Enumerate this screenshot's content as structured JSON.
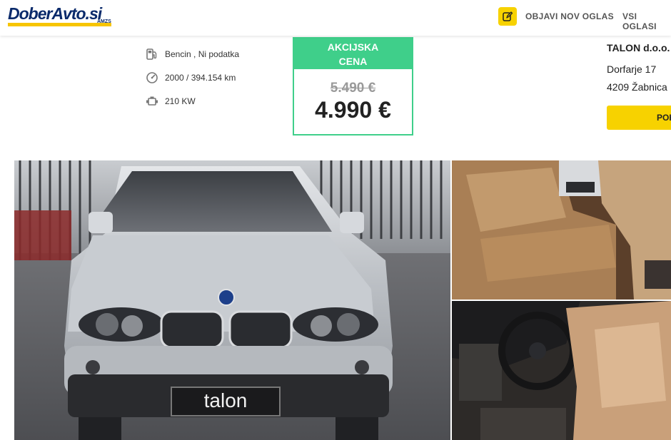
{
  "header": {
    "logo_text": "DoberAvto.si",
    "logo_sub": "AMZS",
    "post_ad_label": "OBJAVI NOV OGLAS",
    "all_ads_label": "VSI OGLASI"
  },
  "specs": {
    "fuel": "Bencin , Ni podatka",
    "year_km": "2000 / 394.154 km",
    "power": "210 KW"
  },
  "price": {
    "badge": "AKCIJSKA CENA",
    "old_price": "5.490 €",
    "new_price": "4.990 €"
  },
  "seller": {
    "name": "TALON d.o.o.",
    "street": "Dorfarje 17",
    "city": "4209 Žabnica",
    "button_label": "POKLIČI"
  },
  "gallery": {
    "plate_text": "talon"
  },
  "colors": {
    "accent_yellow": "#f7d200",
    "price_green": "#3fcf8a",
    "logo_blue": "#0a2a6b"
  }
}
